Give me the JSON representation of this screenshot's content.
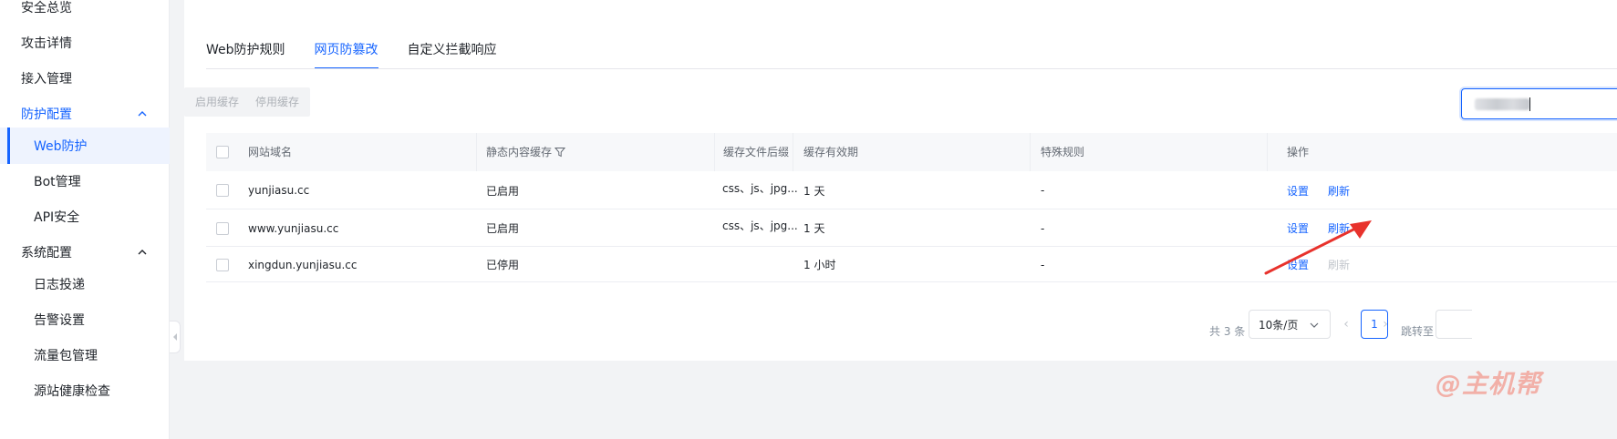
{
  "sidebar": {
    "items": [
      {
        "label": "安全总览"
      },
      {
        "label": "攻击详情"
      },
      {
        "label": "接入管理"
      },
      {
        "label": "防护配置"
      },
      {
        "label": "Web防护"
      },
      {
        "label": "Bot管理"
      },
      {
        "label": "API安全"
      },
      {
        "label": "系统配置"
      },
      {
        "label": "日志投递"
      },
      {
        "label": "告警设置"
      },
      {
        "label": "流量包管理"
      },
      {
        "label": "源站健康检查"
      }
    ]
  },
  "tabs": [
    {
      "label": "Web防护规则"
    },
    {
      "label": "网页防篡改"
    },
    {
      "label": "自定义拦截响应"
    }
  ],
  "toolbar": {
    "enable_cache_label": "启用缓存",
    "disable_cache_label": "停用缓存"
  },
  "table": {
    "headers": [
      "网站域名",
      "静态内容缓存",
      "缓存文件后缀",
      "缓存有效期",
      "特殊规则",
      "操作"
    ],
    "rows": [
      {
        "domain": "yunjiasu.cc",
        "cache": "已启用",
        "suffix": "css、js、jpg...",
        "ttl": "1 天",
        "rule": "-",
        "action1": "设置",
        "action2": "刷新"
      },
      {
        "domain": "www.yunjiasu.cc",
        "cache": "已启用",
        "suffix": "css、js、jpg...",
        "ttl": "1 天",
        "rule": "-",
        "action1": "设置",
        "action2": "刷新"
      },
      {
        "domain": "xingdun.yunjiasu.cc",
        "cache": "已停用",
        "suffix": "",
        "ttl": "1 小时",
        "rule": "-",
        "action1": "设置",
        "action2": "刷新"
      }
    ]
  },
  "pagination": {
    "total": "共 3 条",
    "page_size": "10条/页",
    "current_page": "1",
    "jump_label": "跳转至"
  },
  "watermark": "@主机帮",
  "colors": {
    "accent": "#1664ff",
    "arrow": "#e8322c"
  }
}
